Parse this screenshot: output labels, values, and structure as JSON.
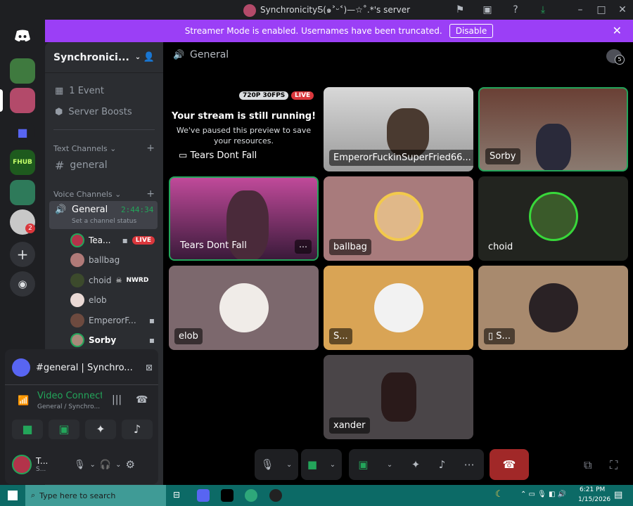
{
  "window": {
    "title": "SynchronicityƼ(๑˃ᵕ˂)—☆˚.*'s server"
  },
  "banner": {
    "text": "Streamer Mode is enabled. Usernames have been truncated.",
    "button": "Disable"
  },
  "server": {
    "name": "Synchronici...",
    "guild_badge": "2",
    "fhub_label": "FHUB"
  },
  "sidebar": {
    "event": "1 Event",
    "boosts": "Server Boosts",
    "text_category": "Text Channels",
    "text_channel": "general",
    "voice_category": "Voice Channels",
    "voice_channel": "General",
    "timer": "2:44:34",
    "status": "Set a channel status",
    "users": [
      {
        "name": "Tea...",
        "badge": "LIVE",
        "color": "#b3334a"
      },
      {
        "name": "ballbag",
        "badge": "",
        "color": "#b07a78"
      },
      {
        "name": "choid",
        "badge": "NWRD",
        "color": "#3c4a2c"
      },
      {
        "name": "elob",
        "badge": "",
        "color": "#ead9d5"
      },
      {
        "name": "EmperorF...",
        "badge": "",
        "color": "#6d4a3f"
      },
      {
        "name": "Sorby",
        "badge": "",
        "color": "#a88a7a"
      }
    ]
  },
  "panel": {
    "activity": "#general | Synchro...",
    "voice_status": "Video Connecte",
    "voice_sub": "General / Synchro...",
    "user_name": "T...",
    "user_sub": "S..."
  },
  "main": {
    "channel": "General",
    "inbox_count": "5"
  },
  "stream": {
    "quality": "720P 30FPS",
    "live": "LIVE",
    "heading": "Your stream is still running!",
    "body": "We've paused this preview to save your resources.",
    "name": "Tears Dont Fall"
  },
  "tiles": [
    {
      "label": "EmperorFuckinSuperFried66..."
    },
    {
      "label": "Sorby"
    },
    {
      "label": "Tears Dont Fall",
      "more": "⋯"
    },
    {
      "label": "ballbag"
    },
    {
      "label": "choid"
    },
    {
      "label": "elob"
    },
    {
      "label": "S..."
    },
    {
      "label": "S..."
    },
    {
      "label": "xander"
    }
  ],
  "controls": {
    "more": "⋯"
  },
  "taskbar": {
    "search": "Type here to search",
    "time": "6:21 PM",
    "date": "1/15/2026"
  },
  "colors": {
    "accent": "#9b3ff6",
    "green": "#23a55a",
    "live": "#da373c",
    "discord": "#5865f2"
  }
}
